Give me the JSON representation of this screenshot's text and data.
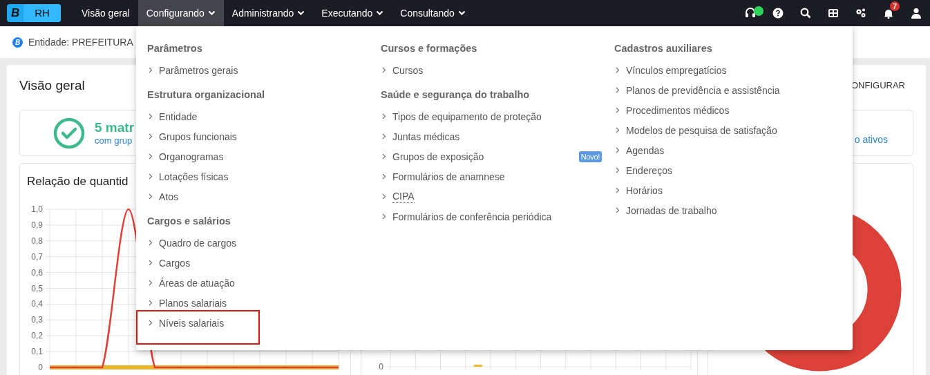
{
  "navbar": {
    "logo": {
      "letter": "B",
      "product": "RH"
    },
    "items": [
      {
        "label": "Visão geral",
        "has_menu": false,
        "selected": false
      },
      {
        "label": "Configurando",
        "has_menu": true,
        "selected": true
      },
      {
        "label": "Administrando",
        "has_menu": true,
        "selected": false
      },
      {
        "label": "Executando",
        "has_menu": true,
        "selected": false
      },
      {
        "label": "Consultando",
        "has_menu": true,
        "selected": false
      }
    ],
    "actions": [
      {
        "kind": "headset",
        "online": true
      },
      {
        "kind": "help"
      },
      {
        "kind": "search"
      },
      {
        "kind": "grid"
      },
      {
        "kind": "gears"
      },
      {
        "kind": "bell",
        "badge": "7"
      },
      {
        "kind": "user"
      }
    ]
  },
  "entity_bar": {
    "icon_letter": "B",
    "text": "Entidade: PREFEITURA"
  },
  "overview": {
    "title": "Visão geral",
    "configure_link": "ONFIGURAR",
    "summary": {
      "headline": "5 matr",
      "subline": "com grup",
      "right_link": "o ativos"
    },
    "panels": [
      {
        "title": "Relação de quantid",
        "chart_data": {
          "type": "line",
          "ylim": [
            0,
            1
          ],
          "grid": true,
          "yticks": [
            {
              "value": 0,
              "label": "0"
            },
            {
              "value": 0.1,
              "label": "0,1"
            },
            {
              "value": 0.2,
              "label": "0,2"
            },
            {
              "value": 0.3,
              "label": "0,3"
            },
            {
              "value": 0.4,
              "label": "0,4"
            },
            {
              "value": 0.5,
              "label": "0,5"
            },
            {
              "value": 0.6,
              "label": "0,6"
            },
            {
              "value": 0.7,
              "label": "0,7"
            },
            {
              "value": 0.8,
              "label": "0,8"
            },
            {
              "value": 0.9,
              "label": "0,9"
            },
            {
              "value": 1,
              "label": "1,0"
            }
          ],
          "series": [
            {
              "color": "#f0b429",
              "values": [
                0,
                0,
                0,
                0,
                0,
                0,
                0,
                0,
                0,
                0,
                0,
                0
              ]
            },
            {
              "color": "#e0403a",
              "values": [
                0,
                0,
                0,
                1,
                0,
                0,
                0,
                0,
                0,
                0,
                0,
                0
              ]
            }
          ]
        }
      },
      {
        "kind": "bar_fragment",
        "tick_label": "0"
      },
      {
        "kind": "donut"
      }
    ]
  },
  "menu": {
    "columns": [
      {
        "groups": [
          {
            "heading": "Parâmetros",
            "items": [
              {
                "label": "Parâmetros gerais",
                "highlighted": false
              }
            ]
          },
          {
            "heading": "Estrutura organizacional",
            "items": [
              {
                "label": "Entidade",
                "highlighted": false
              },
              {
                "label": "Grupos funcionais",
                "highlighted": false
              },
              {
                "label": "Organogramas",
                "highlighted": false
              },
              {
                "label": "Lotações físicas",
                "highlighted": false
              },
              {
                "label": "Atos",
                "highlighted": false
              }
            ]
          },
          {
            "heading": "Cargos e salários",
            "items": [
              {
                "label": "Quadro de cargos",
                "highlighted": false
              },
              {
                "label": "Cargos",
                "highlighted": false
              },
              {
                "label": "Áreas de atuação",
                "highlighted": false
              },
              {
                "label": "Planos salariais",
                "highlighted": false
              },
              {
                "label": "Níveis salariais",
                "highlighted": true
              }
            ]
          }
        ]
      },
      {
        "groups": [
          {
            "heading": "Cursos e formações",
            "items": [
              {
                "label": "Cursos",
                "highlighted": false
              }
            ]
          },
          {
            "heading": "Saúde e segurança do trabalho",
            "items": [
              {
                "label": "Tipos de equipamento de proteção",
                "highlighted": false
              },
              {
                "label": "Juntas médicas",
                "highlighted": false
              },
              {
                "label": "Grupos de exposição",
                "highlighted": false,
                "badge": "Novo!"
              },
              {
                "label": "Formulários de anamnese",
                "highlighted": false
              },
              {
                "label": "CIPA",
                "highlighted": false,
                "abbreviation": true
              },
              {
                "label": "Formulários de conferência periódica",
                "highlighted": false
              }
            ]
          }
        ]
      },
      {
        "groups": [
          {
            "heading": "Cadastros auxiliares",
            "items": [
              {
                "label": "Vínculos empregatícios",
                "highlighted": false
              },
              {
                "label": "Planos de previdência e assistência",
                "highlighted": false
              },
              {
                "label": "Procedimentos médicos",
                "highlighted": false
              },
              {
                "label": "Modelos de pesquisa de satisfação",
                "highlighted": false
              },
              {
                "label": "Agendas",
                "highlighted": false
              },
              {
                "label": "Endereços",
                "highlighted": false
              },
              {
                "label": "Horários",
                "highlighted": false
              },
              {
                "label": "Jornadas de trabalho",
                "highlighted": false
              }
            ]
          }
        ]
      }
    ]
  }
}
